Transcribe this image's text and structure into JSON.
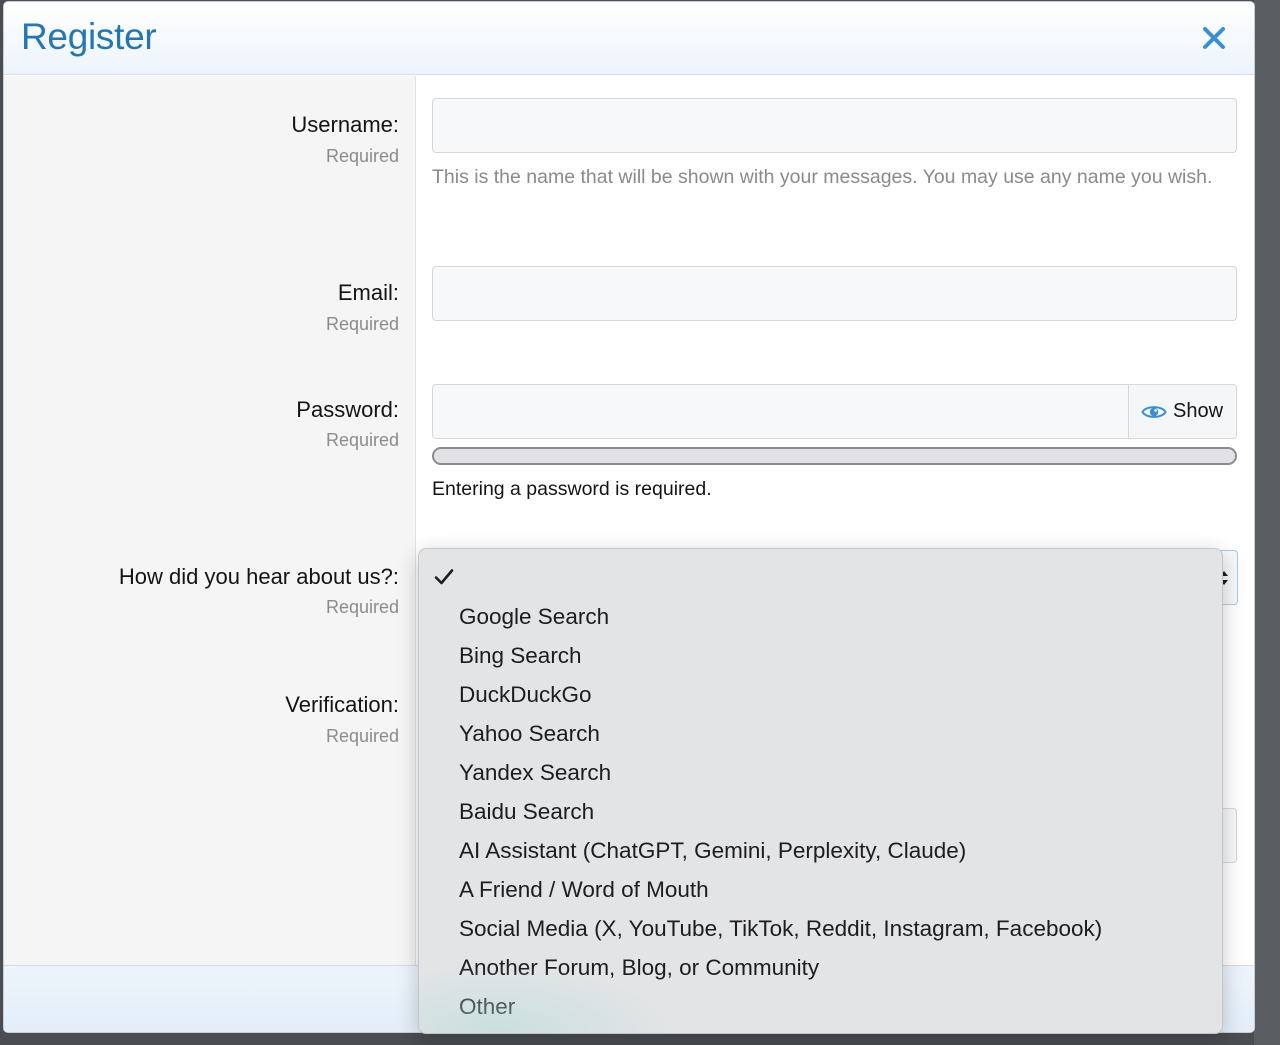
{
  "modal": {
    "title": "Register",
    "close_icon": "close-icon"
  },
  "fields": {
    "username": {
      "label": "Username:",
      "hint": "Required",
      "value": "",
      "explain": "This is the name that will be shown with your messages. You may use any name you wish."
    },
    "email": {
      "label": "Email:",
      "hint": "Required",
      "value": ""
    },
    "password": {
      "label": "Password:",
      "hint": "Required",
      "value": "",
      "show_label": "Show",
      "show_icon": "eye-icon",
      "strength_fraction": 0,
      "message": "Entering a password is required."
    },
    "referral": {
      "label": "How did you hear about us?:",
      "hint": "Required",
      "selected": ""
    },
    "verification": {
      "label": "Verification:",
      "hint": "Required"
    }
  },
  "dropdown": {
    "options": [
      "",
      "Google Search",
      "Bing Search",
      "DuckDuckGo",
      "Yahoo Search",
      "Yandex Search",
      "Baidu Search",
      "AI Assistant (ChatGPT, Gemini, Perplexity, Claude)",
      "A Friend / Word of Mouth",
      "Social Media (X, YouTube, TikTok, Reddit, Instagram, Facebook)",
      "Another Forum, Blog, or Community",
      "Other"
    ],
    "selected_index": 0,
    "check_icon": "checkmark-icon"
  },
  "colors": {
    "title": "#2577b1",
    "close": "#3a8fd0",
    "eye": "#3a8fd0",
    "hint": "#8c8c8c"
  }
}
